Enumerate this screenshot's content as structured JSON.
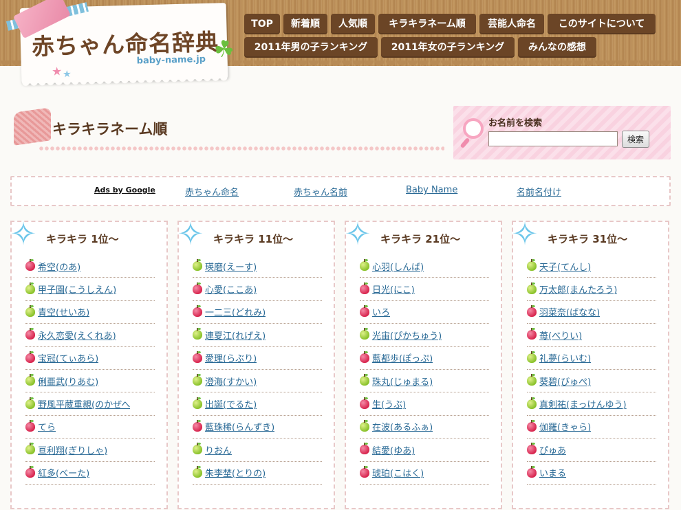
{
  "site": {
    "title": "赤ちゃん命名辞典",
    "domain": "baby-name.jp"
  },
  "nav": {
    "items": [
      {
        "label": "TOP"
      },
      {
        "label": "新着順"
      },
      {
        "label": "人気順"
      },
      {
        "label": "キラキラネーム順"
      },
      {
        "label": "芸能人命名"
      },
      {
        "label": "このサイトについて"
      },
      {
        "label": "2011年男の子ランキング"
      },
      {
        "label": "2011年女の子ランキング"
      },
      {
        "label": "みんなの感想"
      }
    ]
  },
  "page": {
    "heading": "キラキラネーム順"
  },
  "search": {
    "label": "お名前を検索",
    "value": "",
    "button_label": "検索"
  },
  "ads": {
    "label": "Ads by Google",
    "links": [
      "赤ちゃん命名",
      "赤ちゃん名前",
      "Baby Name",
      "名前名付け"
    ]
  },
  "columns": [
    {
      "title": "キラキラ 1位〜",
      "items": [
        {
          "name": "希空(のあ)",
          "icon": "red-apple-icon"
        },
        {
          "name": "甲子園(こうしえん)",
          "icon": "green-apple-icon"
        },
        {
          "name": "青空(せいあ)",
          "icon": "green-apple-icon"
        },
        {
          "name": "永久恋愛(えくれあ)",
          "icon": "red-apple-icon"
        },
        {
          "name": "宝冠(てぃあら)",
          "icon": "red-apple-icon"
        },
        {
          "name": "俐亜武(りあむ)",
          "icon": "green-apple-icon"
        },
        {
          "name": "野風平蔵重親(のかぜへ",
          "icon": "green-apple-icon"
        },
        {
          "name": "てら",
          "icon": "red-apple-icon"
        },
        {
          "name": "亘利翔(ぎりしゃ)",
          "icon": "green-apple-icon"
        },
        {
          "name": "紅多(べーた)",
          "icon": "red-apple-icon"
        }
      ]
    },
    {
      "title": "キラキラ 11位〜",
      "items": [
        {
          "name": "瑛磨(えーす)",
          "icon": "green-apple-icon"
        },
        {
          "name": "心愛(ここあ)",
          "icon": "red-apple-icon"
        },
        {
          "name": "一二三(どれみ)",
          "icon": "red-apple-icon"
        },
        {
          "name": "連夏江(れげえ)",
          "icon": "green-apple-icon"
        },
        {
          "name": "愛理(らぶり)",
          "icon": "red-apple-icon"
        },
        {
          "name": "澄海(すかい)",
          "icon": "green-apple-icon"
        },
        {
          "name": "出誕(でるた)",
          "icon": "green-apple-icon"
        },
        {
          "name": "藍珠稀(らんずき)",
          "icon": "red-apple-icon"
        },
        {
          "name": "りおん",
          "icon": "green-apple-icon"
        },
        {
          "name": "朱李埜(とりの)",
          "icon": "green-apple-icon"
        }
      ]
    },
    {
      "title": "キラキラ 21位〜",
      "items": [
        {
          "name": "心羽(しんば)",
          "icon": "green-apple-icon"
        },
        {
          "name": "日光(にこ)",
          "icon": "red-apple-icon"
        },
        {
          "name": "いろ",
          "icon": "red-apple-icon"
        },
        {
          "name": "光宙(ぴかちゅう)",
          "icon": "green-apple-icon"
        },
        {
          "name": "藍都歩(ぽっぷ)",
          "icon": "red-apple-icon"
        },
        {
          "name": "珠丸(じゅまる)",
          "icon": "green-apple-icon"
        },
        {
          "name": "生(うぶ)",
          "icon": "red-apple-icon"
        },
        {
          "name": "在波(あるふぁ)",
          "icon": "green-apple-icon"
        },
        {
          "name": "結愛(ゆあ)",
          "icon": "red-apple-icon"
        },
        {
          "name": "琥珀(こはく)",
          "icon": "red-apple-icon"
        }
      ]
    },
    {
      "title": "キラキラ 31位〜",
      "items": [
        {
          "name": "天子(てんし)",
          "icon": "green-apple-icon"
        },
        {
          "name": "万太郎(まんたろう)",
          "icon": "green-apple-icon"
        },
        {
          "name": "羽菜奈(ばなな)",
          "icon": "red-apple-icon"
        },
        {
          "name": "苺(べりい)",
          "icon": "red-apple-icon"
        },
        {
          "name": "礼夢(らいむ)",
          "icon": "green-apple-icon"
        },
        {
          "name": "葵碧(びゅぺ)",
          "icon": "green-apple-icon"
        },
        {
          "name": "真剣祐(まっけんゆう)",
          "icon": "green-apple-icon"
        },
        {
          "name": "伽羅(きゃら)",
          "icon": "red-apple-icon"
        },
        {
          "name": "ぴゅあ",
          "icon": "red-apple-icon"
        },
        {
          "name": "いまる",
          "icon": "red-apple-icon"
        }
      ]
    }
  ]
}
